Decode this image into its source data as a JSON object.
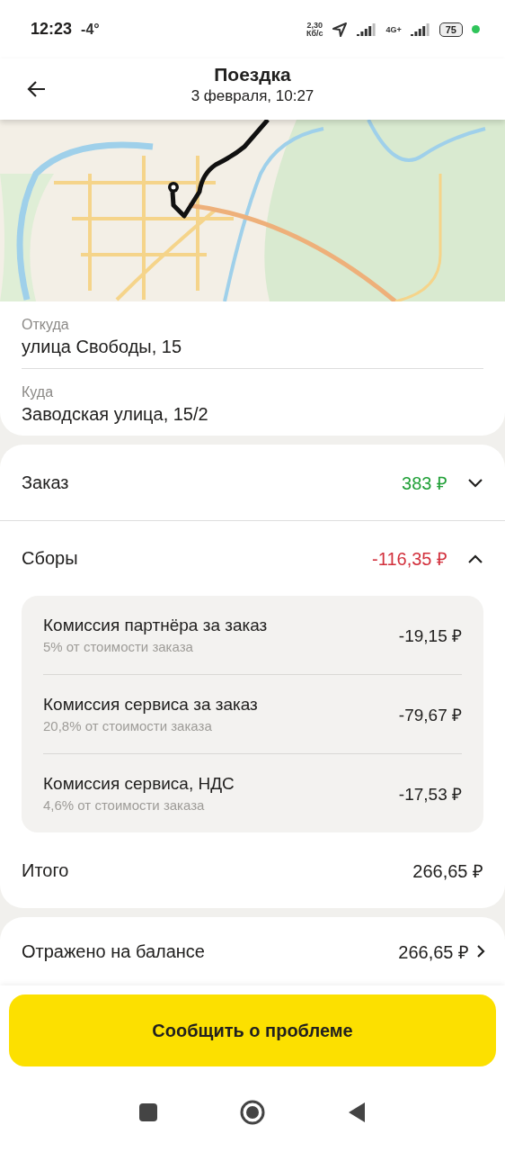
{
  "status_bar": {
    "time": "12:23",
    "temperature": "-4°",
    "speed": "2,30",
    "speed_unit": "Кб/с",
    "network": "4G+",
    "battery": "75"
  },
  "header": {
    "title": "Поездка",
    "subtitle": "3 февраля, 10:27"
  },
  "route": [
    {
      "label": "Откуда",
      "address": "улица Свободы, 15"
    },
    {
      "label": "Куда",
      "address": "Заводская улица, 15/2"
    }
  ],
  "sections": [
    {
      "title": "Заказ",
      "amount": "383 ₽",
      "color": "#21a038",
      "expanded": false
    },
    {
      "title": "Сборы",
      "amount": "-116,35 ₽",
      "color": "#d2303c",
      "expanded": true,
      "items": [
        {
          "name": "Комиссия партнёра за заказ",
          "note": "5% от стоимости заказа",
          "amount": "-19,15 ₽"
        },
        {
          "name": "Комиссия сервиса за заказ",
          "note": "20,8% от стоимости заказа",
          "amount": "-79,67 ₽"
        },
        {
          "name": "Комиссия сервиса, НДС",
          "note": "4,6% от стоимости заказа",
          "amount": "-17,53 ₽"
        }
      ]
    }
  ],
  "total": {
    "label": "Итого",
    "amount": "266,65 ₽"
  },
  "balance": {
    "label": "Отражено на балансе",
    "amount": "266,65 ₽"
  },
  "action_button": "Сообщить о проблеме"
}
